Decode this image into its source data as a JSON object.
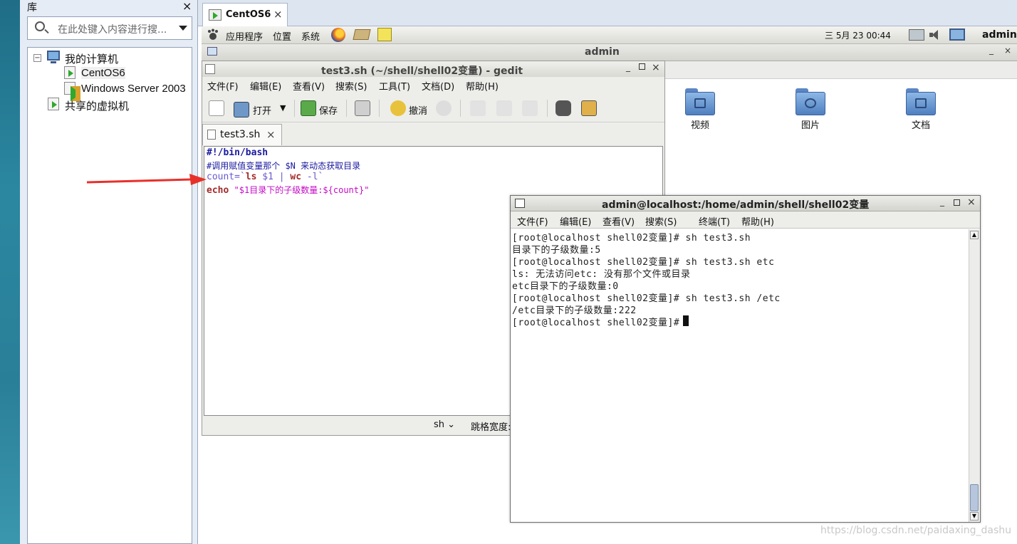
{
  "library": {
    "title": "库",
    "close": "×",
    "search_placeholder": "在此处键入内容进行搜...",
    "tree": [
      {
        "label": "我的计算机",
        "expander": "−"
      },
      {
        "label": "CentOS6"
      },
      {
        "label": "Windows Server 2003"
      },
      {
        "label": "共享的虚拟机"
      }
    ]
  },
  "vm_tab": {
    "label": "CentOS6",
    "close": "×"
  },
  "gnome_panel": {
    "menus": [
      "应用程序",
      "位置",
      "系统"
    ],
    "clock": "三 5月 23 00:44",
    "user": "admin"
  },
  "nautilus": {
    "title": "admin",
    "folders": [
      "视频",
      "图片",
      "文档"
    ]
  },
  "gedit": {
    "title": "test3.sh (~/shell/shell02变量) - gedit",
    "menu": [
      "文件(F)",
      "编辑(E)",
      "查看(V)",
      "搜索(S)",
      "工具(T)",
      "文档(D)",
      "帮助(H)"
    ],
    "toolbar": {
      "open": "打开",
      "save": "保存",
      "undo": "撤消"
    },
    "tab": {
      "label": "test3.sh",
      "close": "×"
    },
    "code": {
      "line1": "#!/bin/bash",
      "line2": "#调用赋值变量那个 $N 来动态获取目录",
      "line3": {
        "a": "count=`",
        "b": "ls",
        "c": " $1 | ",
        "d": "wc",
        "e": " -l`"
      },
      "line4": {
        "a": "echo",
        "b": " \"$1目录下的子级数量:${count}\""
      }
    },
    "status": {
      "lang": "sh",
      "tab_width": "跳格宽度:"
    }
  },
  "terminal": {
    "title": "admin@localhost:/home/admin/shell/shell02变量",
    "menu": [
      "文件(F)",
      "编辑(E)",
      "查看(V)",
      "搜索(S)",
      "终端(T)",
      "帮助(H)"
    ],
    "lines": [
      "[root@localhost shell02变量]# sh test3.sh",
      "目录下的子级数量:5",
      "[root@localhost shell02变量]# sh test3.sh etc",
      "ls: 无法访问etc: 没有那个文件或目录",
      "etc目录下的子级数量:0",
      "[root@localhost shell02变量]# sh test3.sh /etc",
      "/etc目录下的子级数量:222",
      "[root@localhost shell02变量]# "
    ]
  },
  "colors": {
    "arrow": "#e8302a",
    "keyword": "#a52a2a",
    "comment": "#1a1aa0",
    "string": "#c40ac4",
    "variable": "#6a5acd"
  },
  "watermark": "https://blog.csdn.net/paidaxing_dashu"
}
